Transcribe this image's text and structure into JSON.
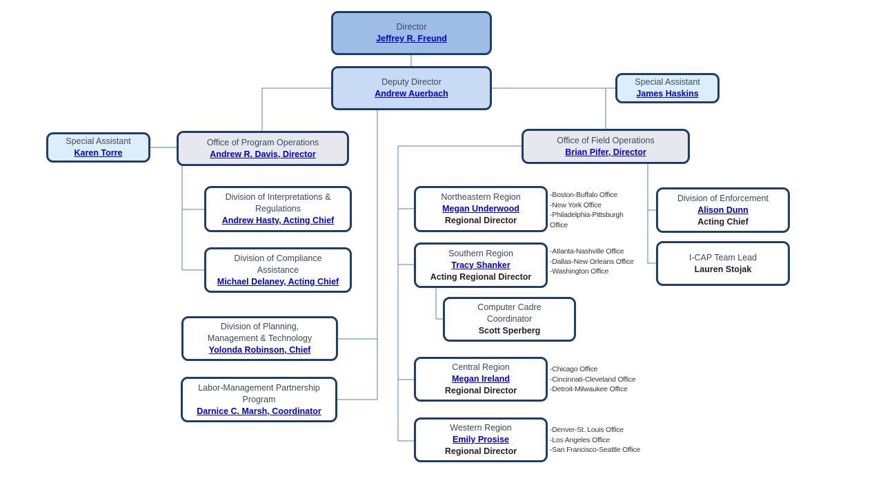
{
  "colors": {
    "border": "#1f3d6b",
    "connector": "#4f81bd",
    "link": "#0000d6",
    "director_fill": "#9dbde6",
    "deputy_fill": "#c9daf5",
    "assistant_fill": "#dceefc",
    "office_fill": "#e6e8ee"
  },
  "director": {
    "title": "Director",
    "name": "Jeffrey R. Freund"
  },
  "deputy": {
    "title": "Deputy Director",
    "name": "Andrew Auerbach"
  },
  "special_assistant_right": {
    "title": "Special Assistant",
    "name": "James Haskins"
  },
  "special_assistant_left": {
    "title": "Special Assistant",
    "name": "Karen Torre"
  },
  "program_operations": {
    "title": "Office of  Program Operations",
    "name": "Andrew R. Davis, Director",
    "divisions": [
      {
        "title_lines": [
          "Division of  Interpretations  &",
          "Regulations"
        ],
        "name": "Andrew Hasty, Acting Chief"
      },
      {
        "title_lines": [
          "Division of Compliance",
          "Assistance"
        ],
        "name": "Michael Delaney, Acting Chief"
      }
    ]
  },
  "deputy_units": [
    {
      "title_lines": [
        "Division of  Planning,",
        "Management & Technology"
      ],
      "name": "Yolonda Robinson, Chief"
    },
    {
      "title_lines": [
        "Labor-Management Partnership",
        "Program"
      ],
      "name": "Darnice C. Marsh, Coordinator"
    }
  ],
  "field_operations": {
    "title": "Office of Field Operations",
    "name": "Brian Pifer, Director",
    "regions": [
      {
        "title": "Northeastern Region",
        "name": "Megan Underwood",
        "role": "Regional Director",
        "offices": [
          "-Boston-Buffalo Office",
          "-New York Office",
          "-Philadelphia-Pittsburgh",
          "Office"
        ]
      },
      {
        "title": "Southern Region",
        "name": "Tracy Shanker",
        "role": "Acting Regional Director",
        "offices": [
          "-Atlanta-Nashville Office",
          "-Dallas-New Orleans Office",
          "-Washington Office"
        ]
      },
      {
        "title": "Central Region",
        "name": "Megan Ireland",
        "role": "Regional Director",
        "offices": [
          "-Chicago Office",
          "-Cincinnati-Cleveland  Office",
          "-Detroit-Milwaukee Office"
        ]
      },
      {
        "title": "Western Region",
        "name": "Emily Prosise",
        "role": "Regional Director",
        "offices": [
          "-Denver-St. Louis Office",
          "-Los Angeles Office",
          "-San Francisco-Seattle  Office"
        ]
      }
    ],
    "computer_cadre": {
      "title_lines": [
        "Computer Cadre",
        "Coordinator"
      ],
      "person": "Scott Sperberg"
    },
    "enforcement": {
      "title": "Division of  Enforcement",
      "name": "Alison Dunn",
      "role": "Acting Chief"
    },
    "icap": {
      "title": "I-CAP Team Lead",
      "person": "Lauren Stojak"
    }
  }
}
